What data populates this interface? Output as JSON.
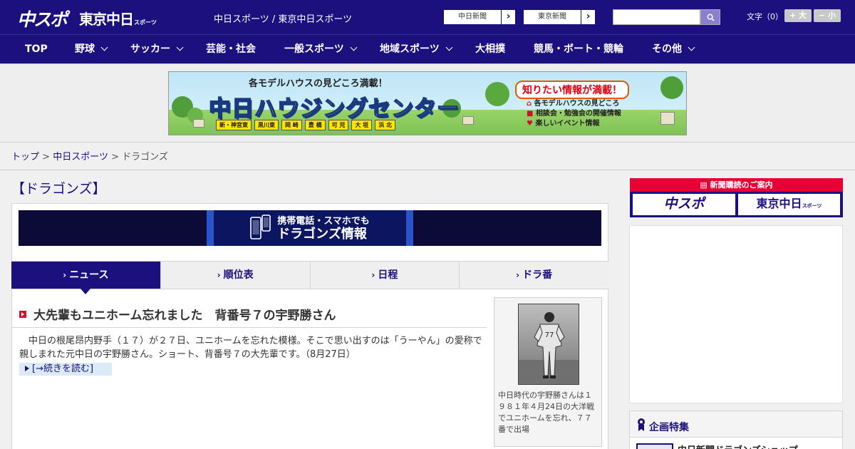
{
  "header": {
    "logo_chuspo": "中スポ",
    "logo_tokyo": "東京中日",
    "logo_tokyo_sub": "スポーツ",
    "site_title": "中日スポーツ / 東京中日スポーツ",
    "chunichi_button": "中日新聞",
    "tokyo_button": "東京新聞",
    "search_placeholder": "",
    "font_size_label": "文字（0）",
    "font_larger": "+ 大",
    "font_smaller": "− 小"
  },
  "nav": {
    "items": [
      {
        "label": "TOP",
        "dropdown": false
      },
      {
        "label": "野球",
        "dropdown": true
      },
      {
        "label": "サッカー",
        "dropdown": true
      },
      {
        "label": "芸能・社会",
        "dropdown": false
      },
      {
        "label": "一般スポーツ",
        "dropdown": true
      },
      {
        "label": "地域スポーツ",
        "dropdown": true
      },
      {
        "label": "大相撲",
        "dropdown": false
      },
      {
        "label": "競馬・ボート・競輪",
        "dropdown": false
      },
      {
        "label": "その他",
        "dropdown": true
      }
    ]
  },
  "ad_banner": {
    "top_line": "各モデルハウスの見どころ満載！",
    "main_line": "中日ハウジングセンター",
    "cities": [
      "新・神宮東",
      "黒川東",
      "岡 崎",
      "豊 橋",
      "可 児",
      "大 垣",
      "浜 北"
    ],
    "right_title": "知りたい情報が満載！",
    "right_items": [
      "各モデルハウスの見どころ",
      "相談会・勉強会の開催情報",
      "楽しいイベント情報"
    ]
  },
  "breadcrumb": {
    "home": "トップ",
    "section": "中日スポーツ",
    "current": "ドラゴンズ",
    "separator": ">"
  },
  "page_title": "【ドラゴンズ】",
  "mobile_banner": {
    "line1": "携帯電話・スマホでも",
    "line2": "ドラゴンズ情報"
  },
  "tabs": [
    {
      "label": "ニュース",
      "active": true
    },
    {
      "label": "順位表",
      "active": false
    },
    {
      "label": "日程",
      "active": false
    },
    {
      "label": "ドラ番",
      "active": false
    }
  ],
  "article": {
    "title": "大先輩もユニホーム忘れました　背番号７の宇野勝さん",
    "body": "中日の根尾昂内野手（１７）が２７日、ユニホームを忘れた模様。そこで思い出すのは「うーやん」の愛称で親しまれた元中日の宇野勝さん。ショート、背番号７の大先輩です。（8月27日）",
    "read_more": "[→続きを読む]",
    "photo_caption": "中日時代の宇野勝さんは１９８１年４月24日の大洋戦でユニホームを忘れ、７７番で出場"
  },
  "sidebar": {
    "subscribe_head": "新聞購読のご案内",
    "sub_chuspo": "中スポ",
    "sub_tokyo": "東京中日",
    "sub_tokyo_small": "スポーツ",
    "feature_title": "企画特集",
    "feature_item": "中日新聞ドラゴンズショップ"
  },
  "colors": {
    "brand_navy": "#1c0f7e",
    "accent_red": "#e60033"
  }
}
